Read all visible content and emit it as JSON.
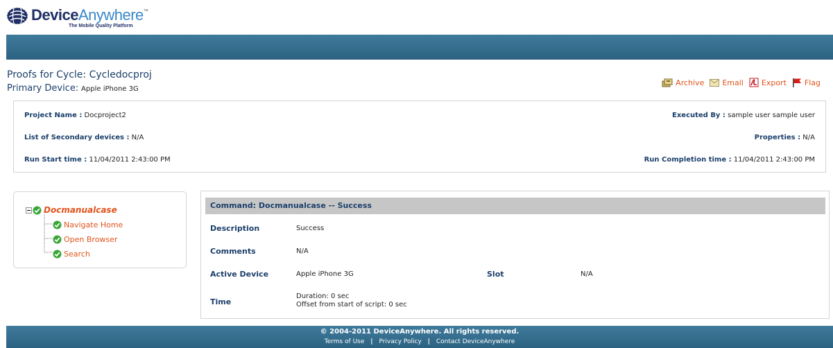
{
  "logo": {
    "brand_part1": "Device",
    "brand_part2": "Anywhere",
    "trademark": "™",
    "tagline": "The Mobile Quality Platform"
  },
  "page": {
    "title": "Proofs for Cycle: Cycledocproj",
    "primary_device_label": "Primary Device:",
    "primary_device_value": "Apple iPhone 3G"
  },
  "actions": [
    {
      "label": "Archive",
      "icon": "archive-icon"
    },
    {
      "label": "Email",
      "icon": "email-icon"
    },
    {
      "label": "Export",
      "icon": "pdf-export-icon"
    },
    {
      "label": "Flag",
      "icon": "flag-icon"
    }
  ],
  "info": {
    "project_name_label": "Project Name :",
    "project_name_value": "Docproject2",
    "executed_by_label": "Executed By :",
    "executed_by_value": "sample user sample user",
    "secondary_label": "List of Secondary devices :",
    "secondary_value": "N/A",
    "properties_label": "Properties :",
    "properties_value": "N/A",
    "run_start_label": "Run Start time :",
    "run_start_value": "11/04/2011 2:43:00 PM",
    "run_complete_label": "Run Completion time :",
    "run_complete_value": "11/04/2011 2:43:00 PM"
  },
  "tree": {
    "root": "Docmanualcase",
    "children": [
      "Navigate Home",
      "Open Browser",
      "Search"
    ]
  },
  "command": {
    "header": "Command: Docmanualcase -- Success",
    "description_label": "Description",
    "description_value": "Success",
    "comments_label": "Comments",
    "comments_value": "N/A",
    "active_device_label": "Active Device",
    "active_device_value": "Apple iPhone 3G",
    "slot_label": "Slot",
    "slot_value": "N/A",
    "time_label": "Time",
    "duration": "Duration: 0 sec",
    "offset": "Offset from start of script: 0 sec"
  },
  "footer": {
    "copyright": "© 2004-2011 DeviceAnywhere. All rights reserved.",
    "links": [
      "Terms of Use",
      "Privacy Policy",
      "Contact DeviceAnywhere"
    ],
    "separator": "|"
  },
  "colors": {
    "accent": "#e0531b",
    "navy": "#1b3f6a",
    "bar": "#346e8e"
  }
}
